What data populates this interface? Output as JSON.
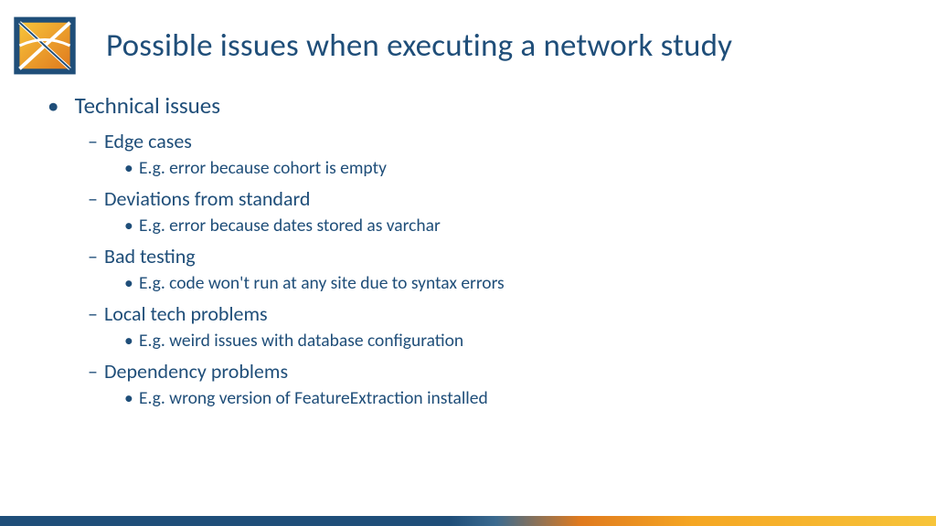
{
  "title": "Possible issues when executing a network study",
  "bullets": {
    "main": "Technical issues",
    "items": [
      {
        "label": "Edge cases",
        "example": "E.g. error because cohort is empty"
      },
      {
        "label": "Deviations from standard",
        "example": "E.g. error because dates stored as varchar"
      },
      {
        "label": "Bad testing",
        "example": "E.g. code won't run at any site due to syntax errors"
      },
      {
        "label": "Local tech problems",
        "example": "E.g. weird issues with database configuration"
      },
      {
        "label": "Dependency problems",
        "example": "E.g. wrong version of FeatureExtraction installed"
      }
    ]
  }
}
